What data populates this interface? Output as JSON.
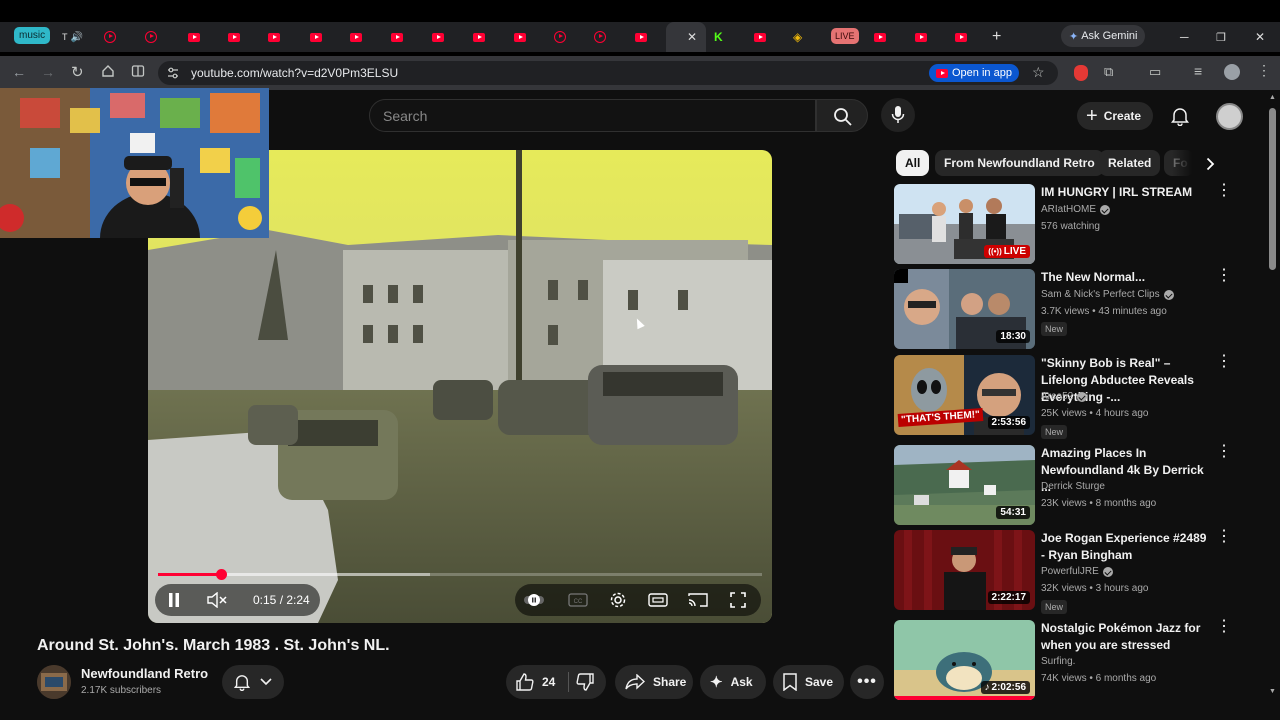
{
  "browser": {
    "tabs": [
      {
        "label": "music"
      },
      {
        "label": "T"
      },
      {
        "label": "LIVE"
      }
    ],
    "url": "youtube.com/watch?v=d2V0Pm3ELSU",
    "open_in_app": "Open in app",
    "ask_gemini": "Ask Gemini"
  },
  "header": {
    "search_placeholder": "Search",
    "create_label": "Create"
  },
  "chips": [
    "All",
    "From Newfoundland Retro",
    "Related",
    "Fo"
  ],
  "player": {
    "time": "0:15 / 2:24",
    "progress_fraction": 0.104,
    "buffered_fraction": 0.45
  },
  "video": {
    "title": "Around St. John's. March 1983 . St. John's NL.",
    "channel": "Newfoundland Retro",
    "subscribers": "2.17K subscribers",
    "likes": "24",
    "share": "Share",
    "ask": "Ask",
    "save": "Save"
  },
  "recommendations": [
    {
      "title": "IM HUNGRY | IRL STREAM",
      "channel": "ARIatHOME",
      "verified": true,
      "meta": "576 watching",
      "badge": "LIVE",
      "new": ""
    },
    {
      "title": "The New Normal...",
      "channel": "Sam & Nick's Perfect Clips",
      "verified": true,
      "meta": "3.7K views • 43 minutes ago",
      "badge": "18:30",
      "new": "New"
    },
    {
      "title": "\"Skinny Bob is Real\" – Lifelong Abductee Reveals Everything -...",
      "channel": "Area52",
      "verified": true,
      "meta": "25K views • 4 hours ago",
      "badge": "2:53:56",
      "new": "New"
    },
    {
      "title": "Amazing Places In Newfoundland 4k By Derrick ...",
      "channel": "Derrick Sturge",
      "verified": false,
      "meta": "23K views • 8 months ago",
      "badge": "54:31",
      "new": ""
    },
    {
      "title": "Joe Rogan Experience #2489 - Ryan Bingham",
      "channel": "PowerfulJRE",
      "verified": true,
      "meta": "32K views • 3 hours ago",
      "badge": "2:22:17",
      "new": "New"
    },
    {
      "title": "Nostalgic Pokémon Jazz for when you are stressed",
      "channel": "Surfing.",
      "verified": false,
      "meta": "74K views • 6 months ago",
      "badge": "2:02:56",
      "new": ""
    }
  ],
  "thumb_text": {
    "rec3": "\"THAT'S THEM!\""
  },
  "colors": {
    "accent": "#ff0033",
    "bg": "#0f0f0f",
    "chip": "#272727"
  }
}
